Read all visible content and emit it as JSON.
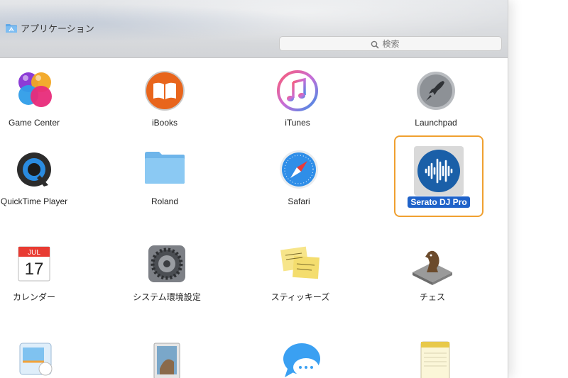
{
  "window": {
    "title": "アプリケーション"
  },
  "search": {
    "placeholder": "検索"
  },
  "apps": [
    {
      "name": "Game Center",
      "icon": "game-center-icon"
    },
    {
      "name": "iBooks",
      "icon": "ibooks-icon"
    },
    {
      "name": "iTunes",
      "icon": "itunes-icon"
    },
    {
      "name": "Launchpad",
      "icon": "launchpad-icon"
    },
    {
      "name": "QuickTime Player",
      "icon": "quicktime-icon"
    },
    {
      "name": "Roland",
      "icon": "folder-icon"
    },
    {
      "name": "Safari",
      "icon": "safari-icon"
    },
    {
      "name": "Serato DJ Pro",
      "icon": "serato-icon",
      "selected": true
    },
    {
      "name": "カレンダー",
      "icon": "calendar-icon",
      "calendar_month": "JUL",
      "calendar_day": "17"
    },
    {
      "name": "システム環境設定",
      "icon": "system-preferences-icon"
    },
    {
      "name": "スティッキーズ",
      "icon": "stickies-icon"
    },
    {
      "name": "チェス",
      "icon": "chess-icon"
    },
    {
      "name": "",
      "icon": "maps-icon"
    },
    {
      "name": "",
      "icon": "preview-icon"
    },
    {
      "name": "",
      "icon": "messages-icon"
    },
    {
      "name": "",
      "icon": "notes-icon"
    }
  ],
  "colors": {
    "selection_frame": "#f0a030",
    "selection_label_bg": "#1f62c9",
    "serato_blue": "#1a5fa8"
  }
}
